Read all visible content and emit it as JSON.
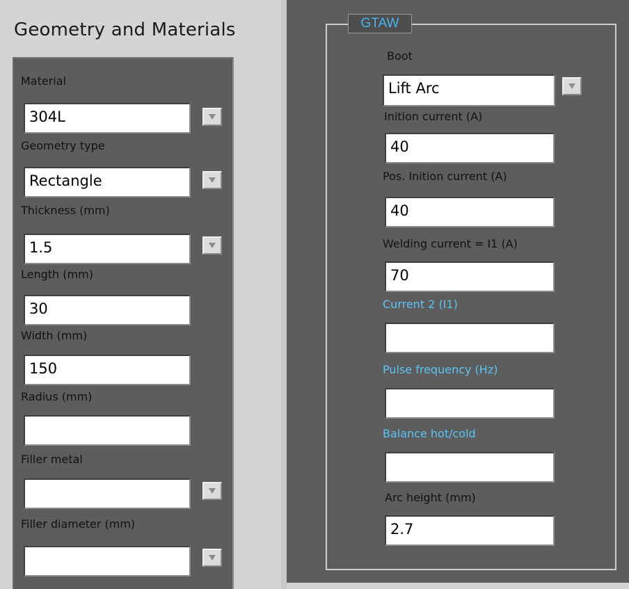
{
  "left": {
    "heading": "Geometry and Materials",
    "fields": [
      {
        "label": "Material",
        "value": "304L",
        "dropdown": true
      },
      {
        "label": "Geometry type",
        "value": "Rectangle",
        "dropdown": true
      },
      {
        "label": "Thickness (mm)",
        "value": "1.5",
        "dropdown": true
      },
      {
        "label": "Length (mm)",
        "value": "30",
        "dropdown": false
      },
      {
        "label": "Width (mm)",
        "value": "150",
        "dropdown": false
      },
      {
        "label": "Radius (mm)",
        "value": "",
        "dropdown": false
      },
      {
        "label": "Filler metal",
        "value": "",
        "dropdown": true
      },
      {
        "label": "Filler diameter (mm)",
        "value": "",
        "dropdown": true
      }
    ]
  },
  "right": {
    "group_title": "GTAW",
    "fields": [
      {
        "label": "Boot",
        "value": "Lift Arc",
        "dropdown": true,
        "enabled": true
      },
      {
        "label": "Inition current (A)",
        "value": "40",
        "dropdown": false,
        "enabled": true
      },
      {
        "label": "Pos. Inition current (A)",
        "value": "40",
        "dropdown": false,
        "enabled": true
      },
      {
        "label": "Welding current = I1 (A)",
        "value": "70",
        "dropdown": false,
        "enabled": true
      },
      {
        "label": "Current 2 (I1)",
        "value": "",
        "dropdown": false,
        "enabled": false
      },
      {
        "label": "Pulse frequency (Hz)",
        "value": "",
        "dropdown": false,
        "enabled": false
      },
      {
        "label": "Balance hot/cold",
        "value": "",
        "dropdown": false,
        "enabled": false
      },
      {
        "label": "Arc height (mm)",
        "value": "2.7",
        "dropdown": false,
        "enabled": true
      }
    ]
  },
  "colors": {
    "panel": "#5d5d5d",
    "background": "#d4d4d4",
    "disabled_label": "#5bc4f5",
    "group_title": "#4ab5f0"
  }
}
